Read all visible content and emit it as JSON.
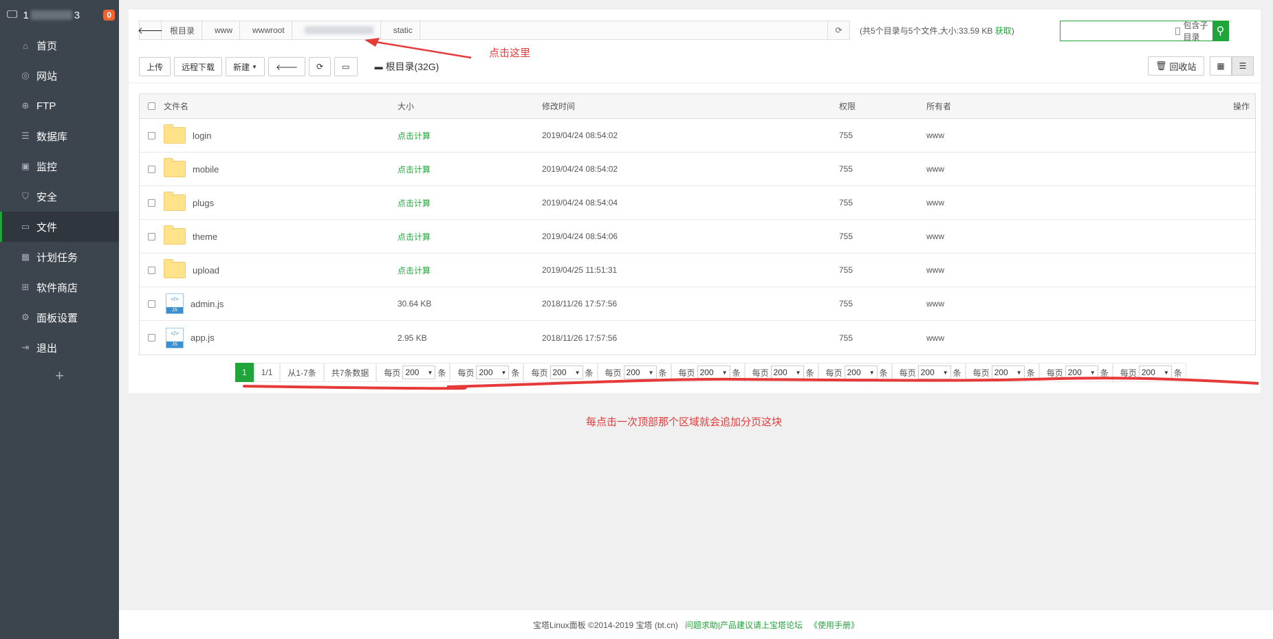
{
  "sidebar": {
    "host_prefix": "1",
    "host_suffix": "3",
    "badge": "0",
    "items": [
      {
        "label": "首页",
        "icon": "home-icon",
        "glyph": "⌂"
      },
      {
        "label": "网站",
        "icon": "globe-icon",
        "glyph": "◎"
      },
      {
        "label": "FTP",
        "icon": "ftp-icon",
        "glyph": "⊕"
      },
      {
        "label": "数据库",
        "icon": "database-icon",
        "glyph": "☰"
      },
      {
        "label": "监控",
        "icon": "monitor-icon",
        "glyph": "▣"
      },
      {
        "label": "安全",
        "icon": "shield-icon",
        "glyph": "⛉"
      },
      {
        "label": "文件",
        "icon": "folder-icon",
        "glyph": "▭"
      },
      {
        "label": "计划任务",
        "icon": "calendar-icon",
        "glyph": "▦"
      },
      {
        "label": "软件商店",
        "icon": "apps-icon",
        "glyph": "⊞"
      },
      {
        "label": "面板设置",
        "icon": "gear-icon",
        "glyph": "⚙"
      },
      {
        "label": "退出",
        "icon": "logout-icon",
        "glyph": "⇥"
      }
    ],
    "add": "+"
  },
  "path": {
    "crumbs": [
      "根目录",
      "www",
      "wwwroot",
      "",
      "static"
    ]
  },
  "dirinfo": {
    "text": "(共5个目录与5个文件,大小:33.59 KB ",
    "get": "获取",
    "close": ")"
  },
  "search": {
    "placeholder": "",
    "subdir_label": "包含子目录"
  },
  "toolbar": {
    "upload": "上传",
    "remote_download": "远程下载",
    "new": "新建",
    "disk": "根目录(32G)",
    "recycle": "回收站"
  },
  "table": {
    "headers": {
      "name": "文件名",
      "size": "大小",
      "time": "修改时间",
      "perm": "权限",
      "owner": "所有者",
      "op": "操作"
    },
    "rows": [
      {
        "type": "folder",
        "name": "login",
        "size": "点击计算",
        "time": "2019/04/24 08:54:02",
        "perm": "755",
        "owner": "www"
      },
      {
        "type": "folder",
        "name": "mobile",
        "size": "点击计算",
        "time": "2019/04/24 08:54:02",
        "perm": "755",
        "owner": "www"
      },
      {
        "type": "folder",
        "name": "plugs",
        "size": "点击计算",
        "time": "2019/04/24 08:54:04",
        "perm": "755",
        "owner": "www"
      },
      {
        "type": "folder",
        "name": "theme",
        "size": "点击计算",
        "time": "2019/04/24 08:54:06",
        "perm": "755",
        "owner": "www"
      },
      {
        "type": "folder",
        "name": "upload",
        "size": "点击计算",
        "time": "2019/04/25 11:51:31",
        "perm": "755",
        "owner": "www"
      },
      {
        "type": "js",
        "name": "admin.js",
        "size": "30.64 KB",
        "time": "2018/11/26 17:57:56",
        "perm": "755",
        "owner": "www"
      },
      {
        "type": "js",
        "name": "app.js",
        "size": "2.95 KB",
        "time": "2018/11/26 17:57:56",
        "perm": "755",
        "owner": "www"
      }
    ]
  },
  "pager": {
    "current": "1",
    "pages": "1/1",
    "range": "从1-7条",
    "total": "共7条数据",
    "per_label": "每页",
    "per_value": "200",
    "per_unit": "条",
    "per_count": 11
  },
  "annotations": {
    "click_here": "点击这里",
    "note": "每点击一次顶部那个区域就会追加分页这块"
  },
  "footer": {
    "copyright": "宝塔Linux面板 ©2014-2019 宝塔 (bt.cn)",
    "help": "问题求助|产品建议请上宝塔论坛",
    "manual": "《使用手册》"
  },
  "colors": {
    "accent": "#20a53a",
    "sidebar": "#3c444d",
    "annotation": "#e63a3a"
  }
}
